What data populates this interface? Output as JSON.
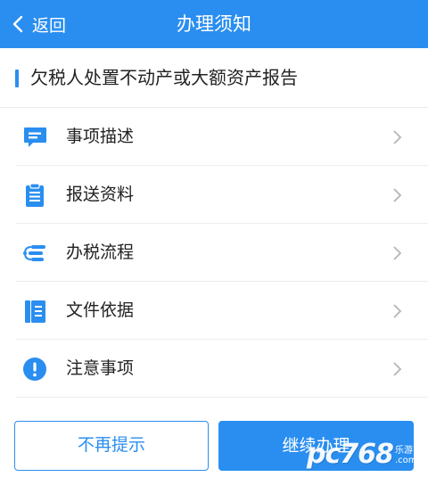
{
  "header": {
    "back_label": "返回",
    "title": "办理须知"
  },
  "section": {
    "title": "欠税人处置不动产或大额资产报告"
  },
  "menu": [
    {
      "label": "事项描述",
      "icon": "message-icon"
    },
    {
      "label": "报送资料",
      "icon": "clipboard-icon"
    },
    {
      "label": "办税流程",
      "icon": "flow-icon"
    },
    {
      "label": "文件依据",
      "icon": "document-icon"
    },
    {
      "label": "注意事项",
      "icon": "alert-icon"
    }
  ],
  "buttons": {
    "dismiss": "不再提示",
    "continue": "继续办理"
  },
  "watermark": {
    "logo": "pc768",
    "sub_top": "乐游",
    "sub_bottom": ".com"
  },
  "colors": {
    "accent": "#2a8ef0",
    "text": "#222222",
    "chevron": "#b5b5b5"
  }
}
